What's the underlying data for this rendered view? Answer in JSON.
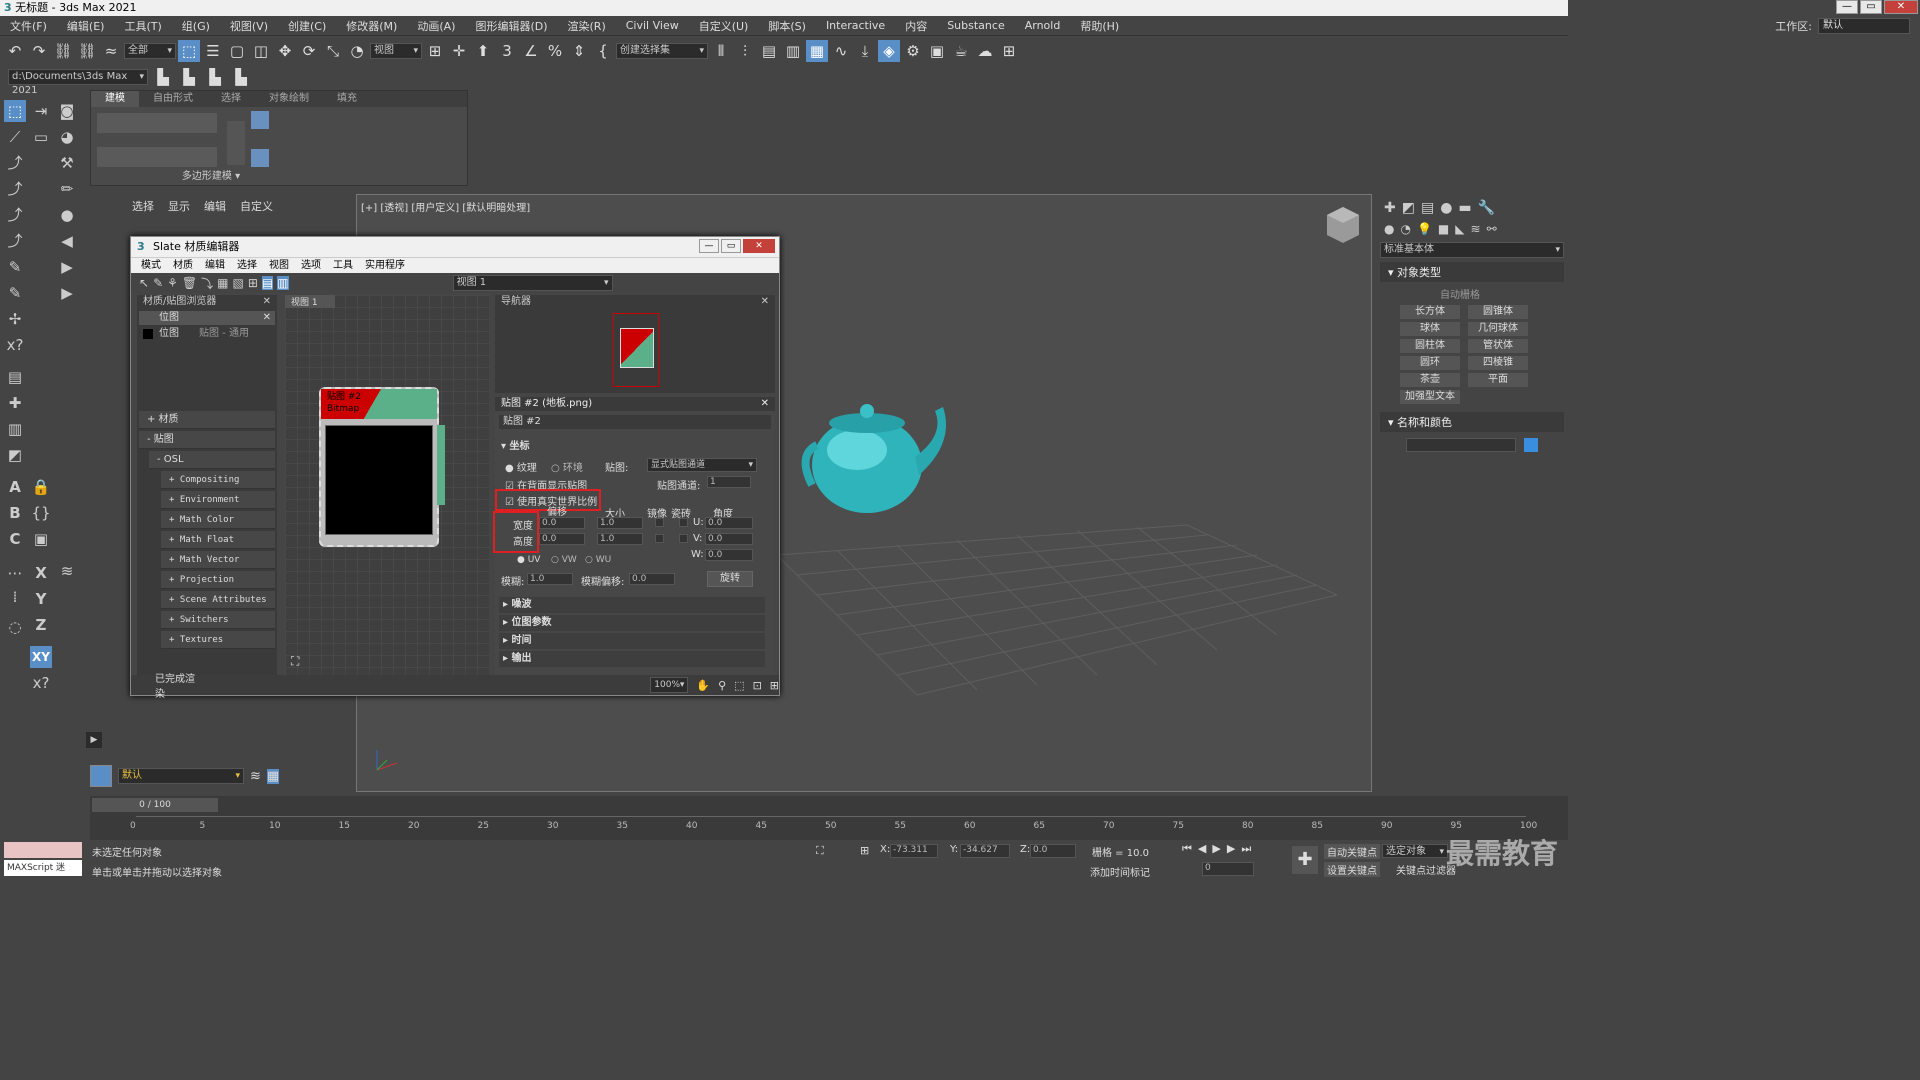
{
  "window": {
    "title": "无标题 - 3ds Max 2021"
  },
  "menu": [
    "文件(F)",
    "编辑(E)",
    "工具(T)",
    "组(G)",
    "视图(V)",
    "创建(C)",
    "修改器(M)",
    "动画(A)",
    "图形编辑器(D)",
    "渲染(R)",
    "Civil View",
    "自定义(U)",
    "脚本(S)",
    "Interactive",
    "内容",
    "Substance",
    "Arnold",
    "帮助(H)"
  ],
  "workspace": {
    "label": "工作区:",
    "value": "默认"
  },
  "toolbar": {
    "filter": "全部",
    "view_ref": "视图",
    "selection_set": "创建选择集"
  },
  "path": {
    "value": "d:\\Documents\\3ds Max 2021"
  },
  "ribbon": {
    "tabs": [
      "建模",
      "自由形式",
      "选择",
      "对象绘制",
      "填充"
    ],
    "group_label": "多边形建模"
  },
  "scene_explorer": {
    "tabs": [
      "选择",
      "显示",
      "编辑",
      "自定义"
    ]
  },
  "viewport": {
    "label": "[+] [透视] [用户定义] [默认明暗处理]"
  },
  "command_panel": {
    "category": "标准基本体",
    "rollout1": "对象类型",
    "autogrid": "自动栅格",
    "objects": [
      "长方体",
      "圆锥体",
      "球体",
      "几何球体",
      "圆柱体",
      "管状体",
      "圆环",
      "四棱锥",
      "茶壶",
      "平面",
      "加强型文本"
    ],
    "rollout2": "名称和颜色"
  },
  "slate": {
    "title": "Slate 材质编辑器",
    "menu": [
      "模式",
      "材质",
      "编辑",
      "选择",
      "视图",
      "选项",
      "工具",
      "实用程序"
    ],
    "view_dropdown": "视图 1",
    "browser_title": "材质/贴图浏览器",
    "search_value": "位图",
    "result_name": "位图",
    "result_type": "贴图 - 通用",
    "cat_material": "+ 材质",
    "cat_map": "- 贴图",
    "cat_osl": "- OSL",
    "osl_items": [
      "+ Compositing",
      "+ Environment",
      "+ Math Color",
      "+ Math Float",
      "+ Math Vector",
      "+ Projection",
      "+ Scene Attributes",
      "+ Switchers",
      "+ Textures"
    ],
    "view_tab": "视图 1",
    "node_title": "贴图 #2",
    "node_type": "Bitmap",
    "navigator_title": "导航器",
    "params_title": "贴图 #2 (地板.png)",
    "map_name": "贴图 #2",
    "coords_header": "坐标",
    "radio_texture": "纹理",
    "radio_env": "环境",
    "mapping_label": "贴图:",
    "mapping_value": "显式贴图通道",
    "show_back": "在背面显示贴图",
    "channel_label": "贴图通道:",
    "channel_value": "1",
    "real_world": "使用真实世界比例",
    "col_offset": "偏移",
    "col_size": "大小",
    "col_mirror": "镜像",
    "col_tile": "瓷砖",
    "col_angle": "角度",
    "width_label": "宽度",
    "height_label": "高度",
    "offset_w": "0.0",
    "offset_h": "0.0",
    "size_w": "1.0",
    "size_h": "1.0",
    "angle_u_label": "U:",
    "angle_u": "0.0",
    "angle_v_label": "V:",
    "angle_v": "0.0",
    "angle_w_label": "W:",
    "angle_w": "0.0",
    "uv": "UV",
    "vw": "VW",
    "wu": "WU",
    "blur_label": "模糊:",
    "blur_value": "1.0",
    "blur_offset_label": "模糊偏移:",
    "blur_offset_value": "0.0",
    "rotate_button": "旋转",
    "rollouts": [
      "噪波",
      "位图参数",
      "时间",
      "输出"
    ],
    "status": "已完成渲染",
    "zoom": "100%"
  },
  "layer": {
    "value": "默认"
  },
  "timeline": {
    "frame": "0 / 100",
    "ticks": [
      "0",
      "5",
      "10",
      "15",
      "20",
      "25",
      "30",
      "35",
      "40",
      "45",
      "50",
      "55",
      "60",
      "65",
      "70",
      "75",
      "80",
      "85",
      "90",
      "95",
      "100"
    ]
  },
  "status": {
    "line1": "未选定任何对象",
    "line2": "单击或单击并拖动以选择对象",
    "maxscript": "MAXScript 迷",
    "x_label": "X:",
    "x_value": "-73.311",
    "y_label": "Y:",
    "y_value": "-34.627",
    "z_label": "Z:",
    "z_value": "0.0",
    "grid": "栅格 = 10.0",
    "add_time_tag": "添加时间标记",
    "auto_key": "自动关键点",
    "selected": "选定对象",
    "set_key": "设置关键点",
    "key_filter": "关键点过滤器",
    "frame_value": "0"
  },
  "watermark": "最需教育"
}
